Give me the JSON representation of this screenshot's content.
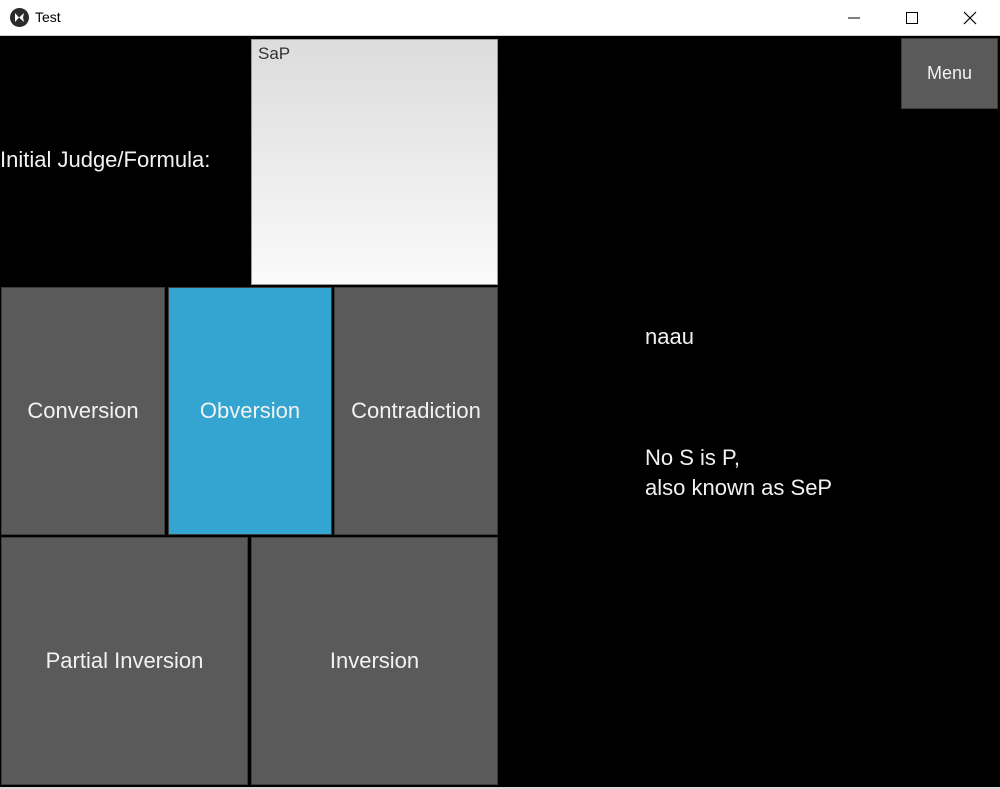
{
  "window": {
    "title": "Test",
    "icon": "kivy-logo-icon"
  },
  "form": {
    "label": "Initial Judge/Formula:",
    "formula_value": "SaP"
  },
  "operations": [
    {
      "label": "Conversion",
      "active": false
    },
    {
      "label": "Obversion",
      "active": true
    },
    {
      "label": "Contradiction",
      "active": false
    },
    {
      "label": "Partial Inversion",
      "active": false
    },
    {
      "label": "Inversion",
      "active": false
    }
  ],
  "menu": {
    "label": "Menu"
  },
  "result": {
    "code": "naau",
    "line1": "No S is P,",
    "line2": "also known as SeP"
  },
  "colors": {
    "active": "#33a5d0",
    "tile": "#5a5a5a",
    "background": "#000000"
  }
}
